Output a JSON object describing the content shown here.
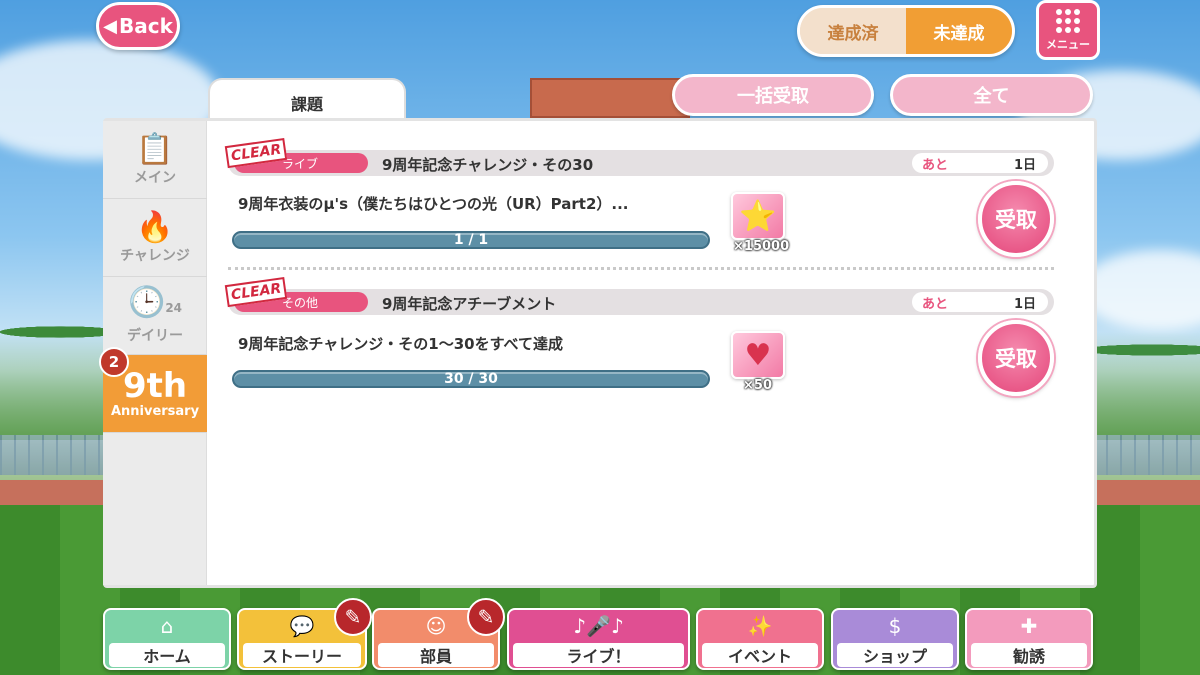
{
  "header": {
    "back_label": "Back",
    "toggle": {
      "achieved": "達成済",
      "unachieved": "未達成"
    },
    "menu_label": "メニュー"
  },
  "panel": {
    "tab_label": "課題",
    "bulk_receive_label": "一括受取",
    "all_label": "全て"
  },
  "sidebar": {
    "items": [
      {
        "label": "メイン",
        "icon": "clipboard-check-icon"
      },
      {
        "label": "チャレンジ",
        "icon": "flame-icon"
      },
      {
        "label": "デイリー",
        "icon": "clock-24-icon",
        "sub": "24"
      },
      {
        "label": "Anniversary",
        "number": "9th",
        "icon": "sparkle-icon",
        "badge": "2"
      }
    ]
  },
  "quests": [
    {
      "stamp": "CLEAR",
      "category": "ライブ",
      "title": "9周年記念チャレンジ・その30",
      "remaining_label": "あと",
      "remaining_value": "1日",
      "description": "9周年衣装のμ's（僕たちはひとつの光（UR）Part2）...",
      "progress": "1 / 1",
      "progress_fraction": 1.0,
      "reward_icon": "rainbow-star-icon",
      "reward_qty": "×15000",
      "receive_label": "受取"
    },
    {
      "stamp": "CLEAR",
      "category": "その他",
      "title": "9周年記念アチーブメント",
      "remaining_label": "あと",
      "remaining_value": "1日",
      "description": "9周年記念チャレンジ・その1～30をすべて達成",
      "progress": "30 / 30",
      "progress_fraction": 1.0,
      "reward_icon": "heart-icon",
      "reward_qty": "×50",
      "receive_label": "受取"
    }
  ],
  "bottom_nav": [
    {
      "label": "ホーム",
      "icon": "home-icon",
      "color": "#7dd3a8"
    },
    {
      "label": "ストーリー",
      "icon": "speech-bubble-icon",
      "color": "#f3c13a",
      "alert": true
    },
    {
      "label": "部員",
      "icon": "member-icon",
      "color": "#f28c6b",
      "alert": true
    },
    {
      "label": "ライブ！",
      "icon": "microphone-icon",
      "color": "#e04f92"
    },
    {
      "label": "イベント",
      "icon": "event-sparkle-icon",
      "color": "#f0718f"
    },
    {
      "label": "ショップ",
      "icon": "dollar-coin-icon",
      "color": "#a98bd8"
    },
    {
      "label": "勧誘",
      "icon": "recruit-plus-icon",
      "color": "#f39bbd"
    }
  ],
  "colors": {
    "brand_pink": "#e8547e",
    "toggle_active": "#f19e34",
    "progress_fill": "#5d8fa6",
    "sidebar_active": "#f29c37"
  }
}
